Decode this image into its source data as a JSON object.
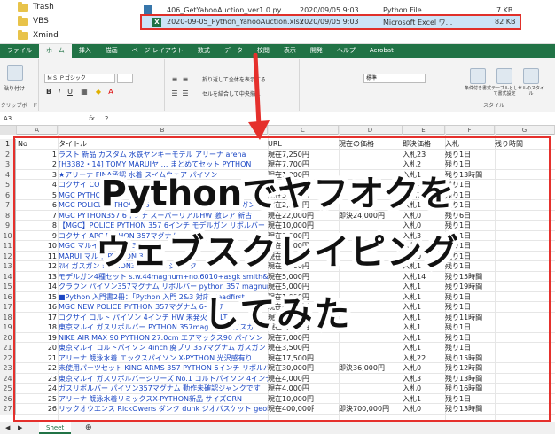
{
  "explorer": {
    "folders": [
      "Trash",
      "VBS",
      "Xmind"
    ],
    "files": [
      {
        "name": "406_GetYahooAuction_ver1.0.py",
        "date": "2020/09/05 9:03",
        "type": "Python File",
        "size": "7 KB"
      },
      {
        "name": "2020-09-05_Python_YahooAuction.xlsx",
        "date": "2020/09/05 9:03",
        "type": "Microsoft Excel ワ...",
        "size": "82 KB",
        "selected": true
      }
    ]
  },
  "ribbon": {
    "tabs": [
      "ファイル",
      "ホーム",
      "挿入",
      "描画",
      "ページ レイアウト",
      "数式",
      "データ",
      "校閲",
      "表示",
      "開発",
      "ヘルプ",
      "Acrobat"
    ],
    "active_tab": "ホーム",
    "paste_label": "貼り付け",
    "clipboard_label": "クリップボード",
    "font_name": "ＭＳ Ｐゴシック",
    "wrap_text": "折り返して全体を表示する",
    "merge_center": "セルを結合して中央揃え",
    "number_format": "標準",
    "style_items": [
      "条件付き書式",
      "テーブルとして書式設定",
      "セルのスタイル"
    ],
    "style_group": "スタイル"
  },
  "formula_bar": {
    "cell_ref": "A3",
    "fx": "fx",
    "value": "2"
  },
  "columns": [
    "A",
    "B",
    "C",
    "D",
    "E",
    "F",
    "G"
  ],
  "table": {
    "headers": {
      "no": "No",
      "title": "タイトル",
      "url": "URL",
      "price": "現在の価格",
      "buyout": "即決価格",
      "bids": "入札",
      "remaining": "残り時間"
    },
    "rows": [
      {
        "no": "1",
        "title": "ラスト 新品 カスタム 水鉄ヤンキーモデル アリーナ arena",
        "url": "現在7,250円",
        "price": "",
        "buyout": "入札23",
        "bids": "残り1日",
        "remaining": ""
      },
      {
        "no": "2",
        "title": "[H3382・14] TOMY MARUIヤ … まとめてセット PYTHON",
        "url": "現在7,700円",
        "price": "",
        "buyout": "入札2",
        "bids": "残り1日",
        "remaining": ""
      },
      {
        "no": "3",
        "title": "★アリーナ FINA承認 水着 スイムウェア パイソン",
        "url": "現在1,000円",
        "price": "",
        "buyout": "入札1",
        "bids": "残り13時間",
        "remaining": ""
      },
      {
        "no": "4",
        "title": "コクサイ COLT PYTHON 357",
        "url": "現在3,000円",
        "price": "",
        "buyout": "入札4",
        "bids": "残り1日",
        "remaining": ""
      },
      {
        "no": "5",
        "title": "MGC PYTHON 4インチ",
        "url": "現在5,500円",
        "price": "",
        "buyout": "入札7",
        "bids": "残り1日",
        "remaining": ""
      },
      {
        "no": "6",
        "title": "MGC POLICE PYTHON 375 マグナム リボルバー モデルガン",
        "url": "現在2,200円",
        "price": "",
        "buyout": "入札1",
        "bids": "残り1日",
        "remaining": ""
      },
      {
        "no": "7",
        "title": "MGC PYTHON357 6インチ スーパーリアルHW 激レア 新古",
        "url": "現在22,000円",
        "price": "即決24,000円",
        "buyout": "入札0",
        "bids": "残り6日",
        "remaining": ""
      },
      {
        "no": "8",
        "title": "【MGC】POLICE PYTHON 357 6インチ モデルガン リボルバー",
        "url": "現在10,000円",
        "price": "",
        "buyout": "入札0",
        "bids": "残り1日",
        "remaining": ""
      },
      {
        "no": "9",
        "title": "コクサイ APC PYTHON 357マグナム",
        "url": "現在8,000円",
        "price": "",
        "buyout": "入札3",
        "bids": "残り1日",
        "remaining": ""
      },
      {
        "no": "10",
        "title": "MGC マルイ PYTHON 357",
        "url": "現在3,500円",
        "price": "",
        "buyout": "入札2",
        "bids": "残り1日",
        "remaining": ""
      },
      {
        "no": "11",
        "title": "MARUI マルイ PYTHON 357",
        "url": "現在1,500円",
        "price": "",
        "buyout": "入札0",
        "bids": "残り1日",
        "remaining": ""
      },
      {
        "no": "12",
        "title": "ﾏﾙｲ ガスガン PYTHON357 ASGK ジャンク",
        "url": "現在1,000円",
        "price": "",
        "buyout": "入札1",
        "bids": "残り1日",
        "remaining": ""
      },
      {
        "no": "13",
        "title": "モデルガン4種セット s.w.44magnum+no.6010+asgk smith&wesson",
        "url": "現在5,000円",
        "price": "",
        "buyout": "入札14",
        "bids": "残り15時間",
        "remaining": ""
      },
      {
        "no": "14",
        "title": "クラウン パイソン357マグナム リボルバー python 357 magnum",
        "url": "現在5,000円",
        "price": "",
        "buyout": "入札1",
        "bids": "残り19時間",
        "remaining": ""
      },
      {
        "no": "15",
        "title": "■Python 入門書2冊：「Python 入門 2&3 対応 Headfirst",
        "url": "現在1,000円",
        "price": "",
        "buyout": "入札1",
        "bids": "残り1日",
        "remaining": ""
      },
      {
        "no": "16",
        "title": "MGC NEW POLICE PYTHON 357マグナム 6インチ",
        "url": "現在6,500円",
        "price": "",
        "buyout": "入札1",
        "bids": "残り1日",
        "remaining": ""
      },
      {
        "no": "17",
        "title": "コクサイ コルト パイソン 4インチ HW 未発火 COLT",
        "url": "現在11,000円",
        "price": "",
        "buyout": "入札1",
        "bids": "残り11時間",
        "remaining": ""
      },
      {
        "no": "18",
        "title": "東京マルイ ガスリボルバー PYTHON 357mag 4inch ガスガン",
        "url": "現在9,000円",
        "price": "",
        "buyout": "入札1",
        "bids": "残り1日",
        "remaining": ""
      },
      {
        "no": "19",
        "title": "NIKE AIR MAX 90 PYTHON 27.0cm エアマックス90 パイソン",
        "url": "現在7,000円",
        "price": "",
        "buyout": "入札1",
        "bids": "残り1日",
        "remaining": ""
      },
      {
        "no": "20",
        "title": "東京マルイ コルトパイソン 4inch 廃ブリ 357マグナム ガスガン",
        "url": "現在3,500円",
        "price": "",
        "buyout": "入札1",
        "bids": "残り1日",
        "remaining": ""
      },
      {
        "no": "21",
        "title": "アリーナ 競泳水着 エックスパイソン X-PYTHON 光沢感有り",
        "url": "現在17,500円",
        "price": "",
        "buyout": "入札22",
        "bids": "残り15時間",
        "remaining": ""
      },
      {
        "no": "22",
        "title": "未使用パーツセット KING ARMS 357 PYTHON 6インチ リボルバー",
        "url": "現在30,000円",
        "price": "即決36,000円",
        "buyout": "入札0",
        "bids": "残り12時間",
        "remaining": ""
      },
      {
        "no": "23",
        "title": "東京マルイ ガスリボルバーシリーズ No.1 コルトパイソン 4インチ",
        "url": "現在4,000円",
        "price": "",
        "buyout": "入札3",
        "bids": "残り13時間",
        "remaining": ""
      },
      {
        "no": "24",
        "title": "ガスリボルバー パイソン357マグナム 動作未確認ジャンクです",
        "url": "現在4,000円",
        "price": "",
        "buyout": "入札0",
        "bids": "残り16時間",
        "remaining": ""
      },
      {
        "no": "25",
        "title": "アリーナ 競泳水着リミックスX-PYTHON新品 サイズGRN",
        "url": "現在10,000円",
        "price": "",
        "buyout": "入札1",
        "bids": "残り1日",
        "remaining": ""
      },
      {
        "no": "26",
        "title": "リックオウエンス RickOwens ダンク dunk ジオバスケット geobasket",
        "url": "現在400,000円",
        "price": "即決700,000円",
        "buyout": "入札0",
        "bids": "残り13時間",
        "remaining": ""
      }
    ]
  },
  "sheet_tab": "Sheet",
  "overlay": {
    "line1": "Pythonでヤフオクを",
    "line2": "ウェブスクレイピング",
    "line3": "してみた"
  },
  "colors": {
    "excel_green": "#217346",
    "annotation_red": "#e5302c",
    "link_blue": "#1a46c4"
  }
}
